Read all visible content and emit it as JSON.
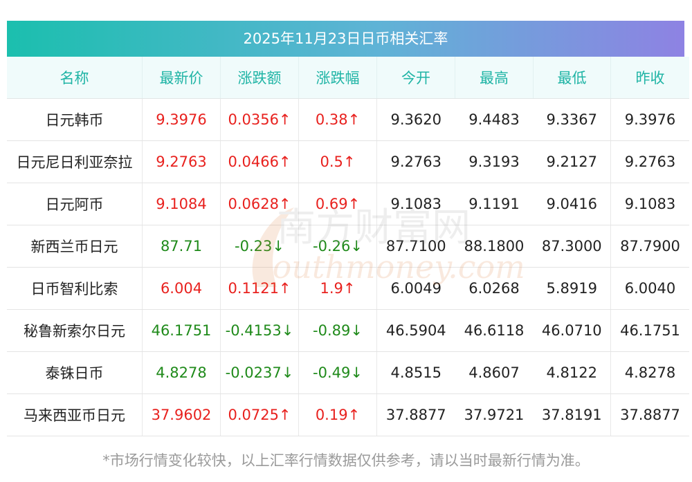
{
  "title": "2025年11月23日日币相关汇率",
  "columns": [
    "名称",
    "最新价",
    "涨跌额",
    "涨跌幅",
    "今开",
    "最高",
    "最低",
    "昨收"
  ],
  "rows": [
    {
      "name": "日元韩币",
      "latest": "9.3976",
      "change": "0.0356↑",
      "pct": "0.38↑",
      "open": "9.3620",
      "high": "9.4483",
      "low": "9.3367",
      "prev": "9.3976",
      "dir": "up"
    },
    {
      "name": "日元尼日利亚奈拉",
      "latest": "9.2763",
      "change": "0.0466↑",
      "pct": "0.5↑",
      "open": "9.2763",
      "high": "9.3193",
      "low": "9.2127",
      "prev": "9.2763",
      "dir": "up"
    },
    {
      "name": "日元阿币",
      "latest": "9.1084",
      "change": "0.0628↑",
      "pct": "0.69↑",
      "open": "9.1083",
      "high": "9.1191",
      "low": "9.0416",
      "prev": "9.1083",
      "dir": "up"
    },
    {
      "name": "新西兰币日元",
      "latest": "87.71",
      "change": "-0.23↓",
      "pct": "-0.26↓",
      "open": "87.7100",
      "high": "88.1800",
      "low": "87.3000",
      "prev": "87.7900",
      "dir": "down"
    },
    {
      "name": "日币智利比索",
      "latest": "6.004",
      "change": "0.1121↑",
      "pct": "1.9↑",
      "open": "6.0049",
      "high": "6.0268",
      "low": "5.8919",
      "prev": "6.0040",
      "dir": "up"
    },
    {
      "name": "秘鲁新索尔日元",
      "latest": "46.1751",
      "change": "-0.4153↓",
      "pct": "-0.89↓",
      "open": "46.5904",
      "high": "46.6118",
      "low": "46.0710",
      "prev": "46.1751",
      "dir": "down"
    },
    {
      "name": "泰铢日币",
      "latest": "4.8278",
      "change": "-0.0237↓",
      "pct": "-0.49↓",
      "open": "4.8515",
      "high": "4.8607",
      "low": "4.8122",
      "prev": "4.8278",
      "dir": "down"
    },
    {
      "name": "马来西亚币日元",
      "latest": "37.9602",
      "change": "0.0725↑",
      "pct": "0.19↑",
      "open": "37.8877",
      "high": "37.9721",
      "low": "37.8191",
      "prev": "37.8877",
      "dir": "up"
    }
  ],
  "footnote": "*市场行情变化较快，以上汇率行情数据仅供参考，请以当时最新行情为准。",
  "watermark": {
    "cn": "南方财富网",
    "en": "southmoney.com"
  },
  "colors": {
    "up": "#e8211e",
    "down": "#1f8a1a",
    "header_text": "#1fb4a5",
    "title_gradient_start": "#1bbfae",
    "title_gradient_end": "#8e82e3"
  }
}
